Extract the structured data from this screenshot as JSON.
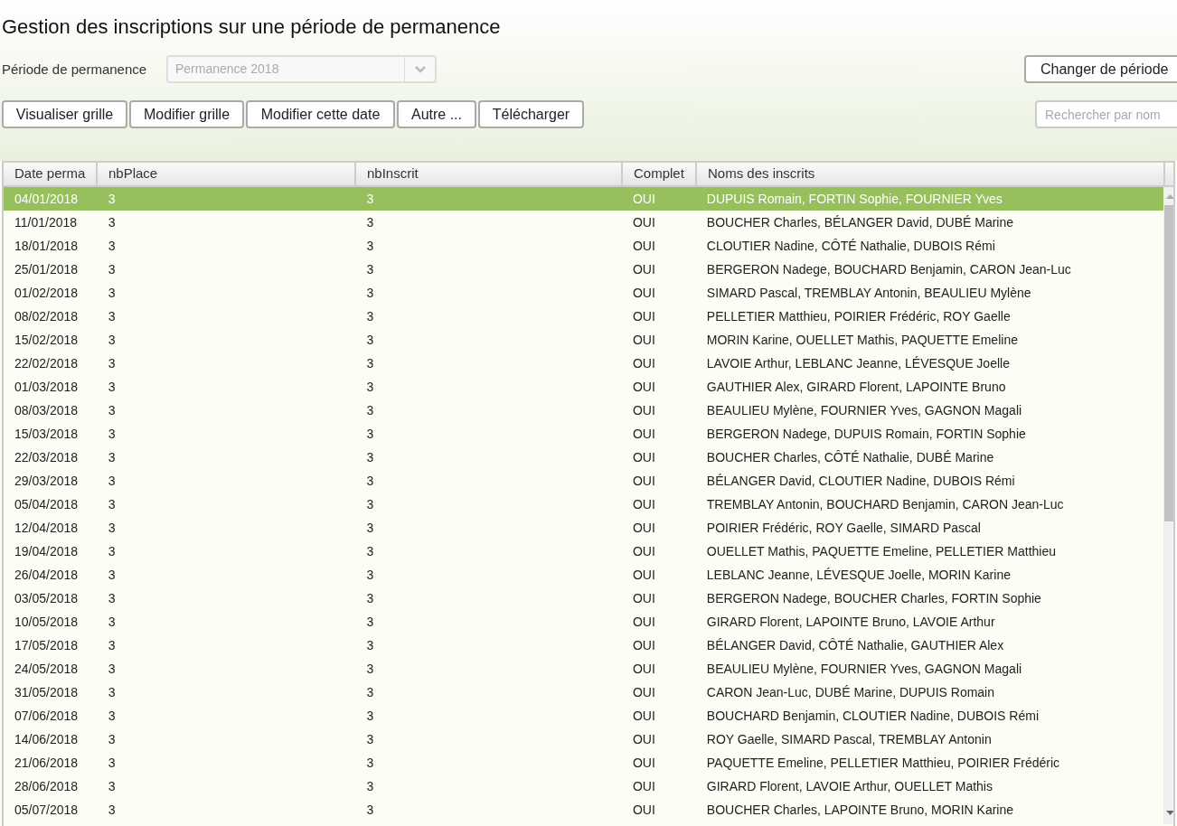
{
  "title": "Gestion des inscriptions sur une période de permanence",
  "period": {
    "label": "Période de permanence",
    "value": "Permanence 2018",
    "disabled": true
  },
  "change_button": "Changer de période",
  "buttons": [
    "Visualiser grille",
    "Modifier grille",
    "Modifier cette date",
    "Autre ...",
    "Télécharger"
  ],
  "search": {
    "placeholder": "Rechercher par nom"
  },
  "table": {
    "columns": [
      "Date perma",
      "nbPlace",
      "nbInscrit",
      "Complet",
      "Noms des inscrits"
    ],
    "rows": [
      {
        "cells": [
          "04/01/2018",
          "3",
          "3",
          "OUI",
          "DUPUIS Romain, FORTIN Sophie, FOURNIER Yves"
        ],
        "selected": true
      },
      {
        "cells": [
          "11/01/2018",
          "3",
          "3",
          "OUI",
          "BOUCHER Charles, BÉLANGER David, DUBÉ Marine"
        ],
        "selected": false
      },
      {
        "cells": [
          "18/01/2018",
          "3",
          "3",
          "OUI",
          "CLOUTIER Nadine, CÔTÉ Nathalie, DUBOIS Rémi"
        ],
        "selected": false
      },
      {
        "cells": [
          "25/01/2018",
          "3",
          "3",
          "OUI",
          "BERGERON Nadege, BOUCHARD Benjamin, CARON Jean-Luc"
        ],
        "selected": false
      },
      {
        "cells": [
          "01/02/2018",
          "3",
          "3",
          "OUI",
          "SIMARD Pascal, TREMBLAY Antonin, BEAULIEU Mylène"
        ],
        "selected": false
      },
      {
        "cells": [
          "08/02/2018",
          "3",
          "3",
          "OUI",
          "PELLETIER Matthieu, POIRIER Frédéric, ROY Gaelle"
        ],
        "selected": false
      },
      {
        "cells": [
          "15/02/2018",
          "3",
          "3",
          "OUI",
          "MORIN Karine, OUELLET Mathis, PAQUETTE Emeline"
        ],
        "selected": false
      },
      {
        "cells": [
          "22/02/2018",
          "3",
          "3",
          "OUI",
          "LAVOIE Arthur, LEBLANC Jeanne, LÉVESQUE Joelle"
        ],
        "selected": false
      },
      {
        "cells": [
          "01/03/2018",
          "3",
          "3",
          "OUI",
          "GAUTHIER Alex, GIRARD Florent, LAPOINTE Bruno"
        ],
        "selected": false
      },
      {
        "cells": [
          "08/03/2018",
          "3",
          "3",
          "OUI",
          "BEAULIEU Mylène, FOURNIER Yves, GAGNON Magali"
        ],
        "selected": false
      },
      {
        "cells": [
          "15/03/2018",
          "3",
          "3",
          "OUI",
          "BERGERON Nadege, DUPUIS Romain, FORTIN Sophie"
        ],
        "selected": false
      },
      {
        "cells": [
          "22/03/2018",
          "3",
          "3",
          "OUI",
          "BOUCHER Charles, CÔTÉ Nathalie, DUBÉ Marine"
        ],
        "selected": false
      },
      {
        "cells": [
          "29/03/2018",
          "3",
          "3",
          "OUI",
          "BÉLANGER David, CLOUTIER Nadine, DUBOIS Rémi"
        ],
        "selected": false
      },
      {
        "cells": [
          "05/04/2018",
          "3",
          "3",
          "OUI",
          "TREMBLAY Antonin, BOUCHARD Benjamin, CARON Jean-Luc"
        ],
        "selected": false
      },
      {
        "cells": [
          "12/04/2018",
          "3",
          "3",
          "OUI",
          "POIRIER Frédéric, ROY Gaelle, SIMARD Pascal"
        ],
        "selected": false
      },
      {
        "cells": [
          "19/04/2018",
          "3",
          "3",
          "OUI",
          "OUELLET Mathis, PAQUETTE Emeline, PELLETIER Matthieu"
        ],
        "selected": false
      },
      {
        "cells": [
          "26/04/2018",
          "3",
          "3",
          "OUI",
          "LEBLANC Jeanne, LÉVESQUE Joelle, MORIN Karine"
        ],
        "selected": false
      },
      {
        "cells": [
          "03/05/2018",
          "3",
          "3",
          "OUI",
          "BERGERON Nadege, BOUCHER Charles, FORTIN Sophie"
        ],
        "selected": false
      },
      {
        "cells": [
          "10/05/2018",
          "3",
          "3",
          "OUI",
          "GIRARD Florent, LAPOINTE Bruno, LAVOIE Arthur"
        ],
        "selected": false
      },
      {
        "cells": [
          "17/05/2018",
          "3",
          "3",
          "OUI",
          "BÉLANGER David, CÔTÉ Nathalie, GAUTHIER Alex"
        ],
        "selected": false
      },
      {
        "cells": [
          "24/05/2018",
          "3",
          "3",
          "OUI",
          "BEAULIEU Mylène, FOURNIER Yves, GAGNON Magali"
        ],
        "selected": false
      },
      {
        "cells": [
          "31/05/2018",
          "3",
          "3",
          "OUI",
          "CARON Jean-Luc, DUBÉ Marine, DUPUIS Romain"
        ],
        "selected": false
      },
      {
        "cells": [
          "07/06/2018",
          "3",
          "3",
          "OUI",
          "BOUCHARD Benjamin, CLOUTIER Nadine, DUBOIS Rémi"
        ],
        "selected": false
      },
      {
        "cells": [
          "14/06/2018",
          "3",
          "3",
          "OUI",
          "ROY Gaelle, SIMARD Pascal, TREMBLAY Antonin"
        ],
        "selected": false
      },
      {
        "cells": [
          "21/06/2018",
          "3",
          "3",
          "OUI",
          "PAQUETTE Emeline, PELLETIER Matthieu, POIRIER Frédéric"
        ],
        "selected": false
      },
      {
        "cells": [
          "28/06/2018",
          "3",
          "3",
          "OUI",
          "GIRARD Florent, LAVOIE Arthur, OUELLET Mathis"
        ],
        "selected": false
      },
      {
        "cells": [
          "05/07/2018",
          "3",
          "3",
          "OUI",
          "BOUCHER Charles, LAPOINTE Bruno, MORIN Karine"
        ],
        "selected": false
      }
    ]
  }
}
